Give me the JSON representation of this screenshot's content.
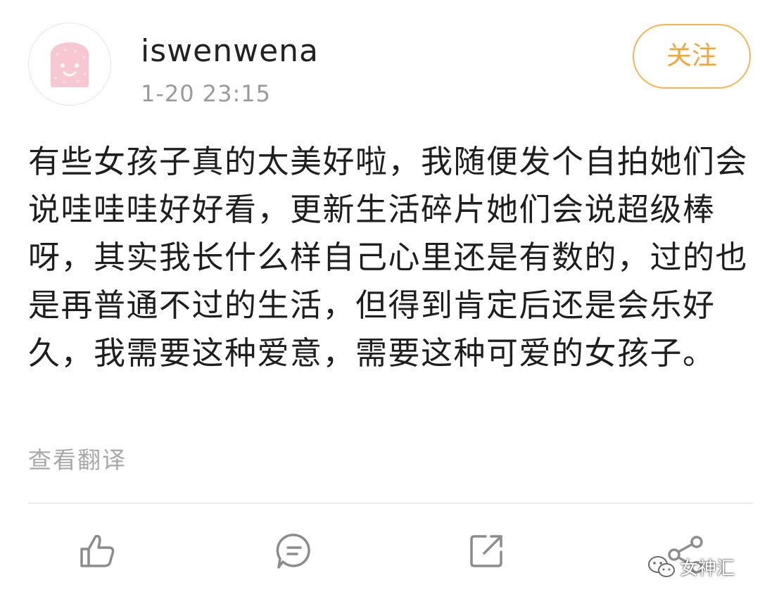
{
  "post": {
    "username": "iswenwena",
    "timestamp": "1-20 23:15",
    "follow_label": "关注",
    "text": "有些女孩子真的太美好啦，我随便发个自拍她们会说哇哇哇好好看，更新生活碎片她们会说超级棒呀，其实我长什么样自己心里还是有数的，过的也是再普通不过的生活，但得到肯定后还是会乐好久，我需要这种爱意，需要这种可爱的女孩子。",
    "translate_label": "查看翻译"
  },
  "actions": [
    {
      "icon": "thumbs-up-icon"
    },
    {
      "icon": "comment-icon"
    },
    {
      "icon": "repost-icon"
    },
    {
      "icon": "share-icon"
    }
  ],
  "watermark": {
    "text": "女神汇",
    "icon": "wechat-icon"
  },
  "colors": {
    "accent": "#f0a63a",
    "muted_text": "#9a9a9a",
    "body_text": "#1e1e1e",
    "avatar_pink": "#f7c8d2"
  }
}
